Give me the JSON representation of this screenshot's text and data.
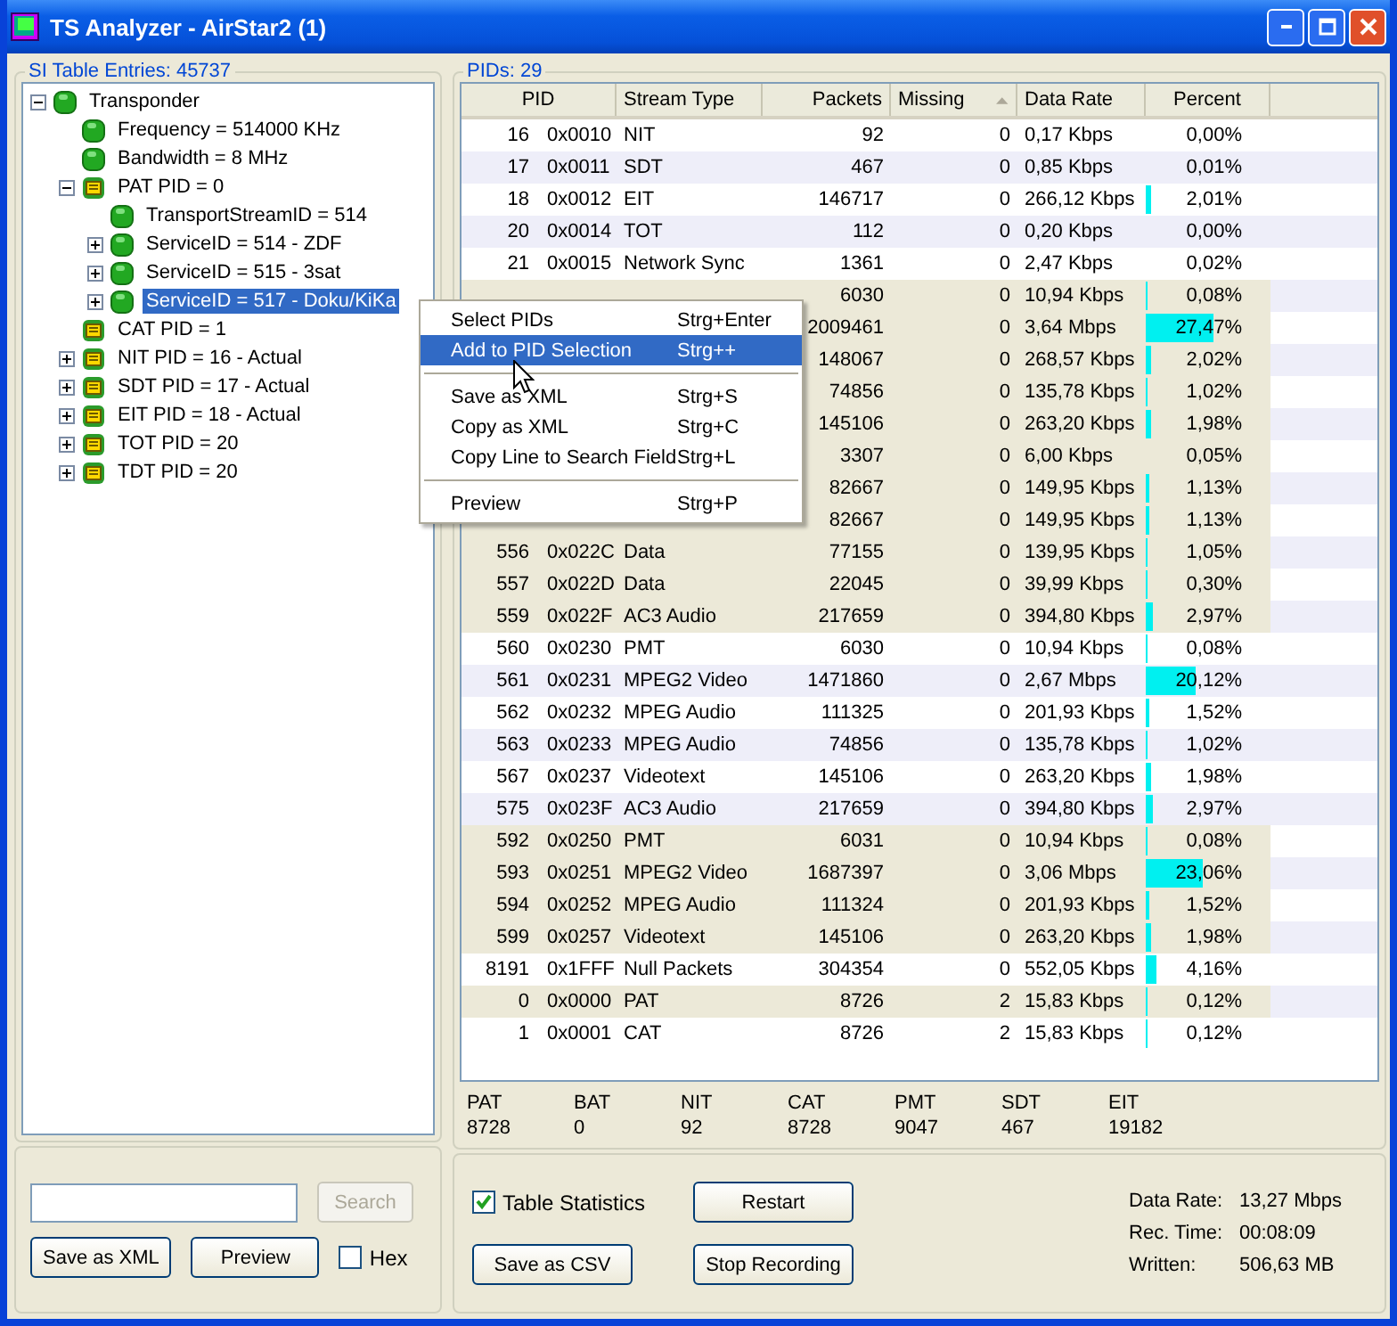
{
  "window": {
    "title": "TS Analyzer - AirStar2 (1)"
  },
  "tree_group": {
    "title": "SI Table Entries: 45737"
  },
  "tree": [
    {
      "label": "Transponder",
      "kind": "ball",
      "expanded": true,
      "selected": false,
      "children": [
        {
          "label": "Frequency = 514000 KHz",
          "kind": "ball",
          "selected": false
        },
        {
          "label": "Bandwidth = 8 MHz",
          "kind": "ball",
          "selected": false
        },
        {
          "label": "PAT PID = 0",
          "kind": "table",
          "expanded": true,
          "selected": false,
          "children": [
            {
              "label": "TransportStreamID = 514",
              "kind": "ball",
              "selected": false
            },
            {
              "label": "ServiceID = 514 - ZDF",
              "kind": "ball",
              "expanded": false,
              "selected": false
            },
            {
              "label": "ServiceID = 515 - 3sat",
              "kind": "ball",
              "expanded": false,
              "selected": false
            },
            {
              "label": "ServiceID = 517 - Doku/KiKa",
              "kind": "ball",
              "expanded": false,
              "selected": true
            }
          ]
        },
        {
          "label": "CAT PID = 1",
          "kind": "table",
          "selected": false
        },
        {
          "label": "NIT PID = 16 - Actual",
          "kind": "table",
          "expanded": false,
          "selected": false
        },
        {
          "label": "SDT PID = 17 - Actual",
          "kind": "table",
          "expanded": false,
          "selected": false
        },
        {
          "label": "EIT PID = 18 - Actual",
          "kind": "table",
          "expanded": false,
          "selected": false
        },
        {
          "label": "TOT PID = 20",
          "kind": "table",
          "expanded": false,
          "selected": false
        },
        {
          "label": "TDT PID = 20",
          "kind": "table",
          "expanded": false,
          "selected": false
        }
      ]
    }
  ],
  "left_controls": {
    "search_button": {
      "label": "Search",
      "disabled": true
    },
    "buttons": [
      {
        "label": "Save as XML",
        "disabled": false
      },
      {
        "label": "Preview",
        "disabled": false
      }
    ],
    "hex": {
      "label": "Hex",
      "checked": false
    }
  },
  "pid_group": {
    "title": "PIDs: 29"
  },
  "table": {
    "columns": [
      {
        "label": "PID",
        "sorted": false
      },
      {
        "label": "Stream Type",
        "sorted": false
      },
      {
        "label": "Packets",
        "sorted": false
      },
      {
        "label": "Missing",
        "sorted": true
      },
      {
        "label": "Data Rate",
        "sorted": false
      },
      {
        "label": "Percent",
        "sorted": false
      }
    ],
    "rows": [
      {
        "pid": "16",
        "hex": "0x0010",
        "type": "NIT",
        "packets": "92",
        "missing": "0",
        "rate": "0,17 Kbps",
        "percent": "0,00%",
        "highlighted": false
      },
      {
        "pid": "17",
        "hex": "0x0011",
        "type": "SDT",
        "packets": "467",
        "missing": "0",
        "rate": "0,85 Kbps",
        "percent": "0,01%",
        "highlighted": false
      },
      {
        "pid": "18",
        "hex": "0x0012",
        "type": "EIT",
        "packets": "146717",
        "missing": "0",
        "rate": "266,12 Kbps",
        "percent": "2,01%",
        "level": 0.0402,
        "highlighted": false
      },
      {
        "pid": "20",
        "hex": "0x0014",
        "type": "TOT",
        "packets": "112",
        "missing": "0",
        "rate": "0,20 Kbps",
        "percent": "0,00%",
        "highlighted": false
      },
      {
        "pid": "21",
        "hex": "0x0015",
        "type": "Network Sync",
        "packets": "1361",
        "missing": "0",
        "rate": "2,47 Kbps",
        "percent": "0,02%",
        "highlighted": false
      },
      {
        "packets": "6030",
        "missing": "0",
        "rate": "10,94 Kbps",
        "percent": "0,08%",
        "level": 0.0016,
        "highlighted": true
      },
      {
        "packets": "2009461",
        "missing": "0",
        "rate": "3,64 Mbps",
        "percent": "27,47%",
        "level": 0.5494,
        "highlighted": true
      },
      {
        "packets": "148067",
        "missing": "0",
        "rate": "268,57 Kbps",
        "percent": "2,02%",
        "level": 0.0404,
        "highlighted": true
      },
      {
        "packets": "74856",
        "missing": "0",
        "rate": "135,78 Kbps",
        "percent": "1,02%",
        "level": 0.0204,
        "highlighted": true
      },
      {
        "packets": "145106",
        "missing": "0",
        "rate": "263,20 Kbps",
        "percent": "1,98%",
        "level": 0.0396,
        "highlighted": true
      },
      {
        "packets": "3307",
        "missing": "0",
        "rate": "6,00 Kbps",
        "percent": "0,05%",
        "level": 0.001,
        "highlighted": true
      },
      {
        "packets": "82667",
        "missing": "0",
        "rate": "149,95 Kbps",
        "percent": "1,13%",
        "level": 0.0226,
        "highlighted": true
      },
      {
        "packets": "82667",
        "missing": "0",
        "rate": "149,95 Kbps",
        "percent": "1,13%",
        "level": 0.0226,
        "highlighted": true
      },
      {
        "pid": "556",
        "hex": "0x022C",
        "type": "Data",
        "packets": "77155",
        "missing": "0",
        "rate": "139,95 Kbps",
        "percent": "1,05%",
        "level": 0.021,
        "highlighted": true
      },
      {
        "pid": "557",
        "hex": "0x022D",
        "type": "Data",
        "packets": "22045",
        "missing": "0",
        "rate": "39,99 Kbps",
        "percent": "0,30%",
        "level": 0.006,
        "highlighted": true
      },
      {
        "pid": "559",
        "hex": "0x022F",
        "type": "AC3 Audio",
        "packets": "217659",
        "missing": "0",
        "rate": "394,80 Kbps",
        "percent": "2,97%",
        "level": 0.0594,
        "highlighted": true
      },
      {
        "pid": "560",
        "hex": "0x0230",
        "type": "PMT",
        "packets": "6030",
        "missing": "0",
        "rate": "10,94 Kbps",
        "percent": "0,08%",
        "level": 0.0016,
        "highlighted": false
      },
      {
        "pid": "561",
        "hex": "0x0231",
        "type": "MPEG2 Video",
        "packets": "1471860",
        "missing": "0",
        "rate": "2,67 Mbps",
        "percent": "20,12%",
        "level": 0.4024,
        "highlighted": false
      },
      {
        "pid": "562",
        "hex": "0x0232",
        "type": "MPEG Audio",
        "packets": "111325",
        "missing": "0",
        "rate": "201,93 Kbps",
        "percent": "1,52%",
        "level": 0.0304,
        "highlighted": false
      },
      {
        "pid": "563",
        "hex": "0x0233",
        "type": "MPEG Audio",
        "packets": "74856",
        "missing": "0",
        "rate": "135,78 Kbps",
        "percent": "1,02%",
        "level": 0.0204,
        "highlighted": false
      },
      {
        "pid": "567",
        "hex": "0x0237",
        "type": "Videotext",
        "packets": "145106",
        "missing": "0",
        "rate": "263,20 Kbps",
        "percent": "1,98%",
        "level": 0.0396,
        "highlighted": false
      },
      {
        "pid": "575",
        "hex": "0x023F",
        "type": "AC3 Audio",
        "packets": "217659",
        "missing": "0",
        "rate": "394,80 Kbps",
        "percent": "2,97%",
        "level": 0.0594,
        "highlighted": false
      },
      {
        "pid": "592",
        "hex": "0x0250",
        "type": "PMT",
        "packets": "6031",
        "missing": "0",
        "rate": "10,94 Kbps",
        "percent": "0,08%",
        "level": 0.0016,
        "highlighted": true
      },
      {
        "pid": "593",
        "hex": "0x0251",
        "type": "MPEG2 Video",
        "packets": "1687397",
        "missing": "0",
        "rate": "3,06 Mbps",
        "percent": "23,06%",
        "level": 0.4612,
        "highlighted": true
      },
      {
        "pid": "594",
        "hex": "0x0252",
        "type": "MPEG Audio",
        "packets": "111324",
        "missing": "0",
        "rate": "201,93 Kbps",
        "percent": "1,52%",
        "level": 0.0304,
        "highlighted": true
      },
      {
        "pid": "599",
        "hex": "0x0257",
        "type": "Videotext",
        "packets": "145106",
        "missing": "0",
        "rate": "263,20 Kbps",
        "percent": "1,98%",
        "level": 0.0396,
        "highlighted": true
      },
      {
        "pid": "8191",
        "hex": "0x1FFF",
        "type": "Null Packets",
        "packets": "304354",
        "missing": "0",
        "rate": "552,05 Kbps",
        "percent": "4,16%",
        "level": 0.0832,
        "highlighted": false
      },
      {
        "pid": "0",
        "hex": "0x0000",
        "type": "PAT",
        "packets": "8726",
        "missing": "2",
        "rate": "15,83 Kbps",
        "percent": "0,12%",
        "level": 0.0024,
        "highlighted": true
      },
      {
        "pid": "1",
        "hex": "0x0001",
        "type": "CAT",
        "packets": "8726",
        "missing": "2",
        "rate": "15,83 Kbps",
        "percent": "0,12%",
        "level": 0.0024,
        "highlighted": false
      }
    ]
  },
  "table_counts": [
    {
      "label": "PAT",
      "value": "8728"
    },
    {
      "label": "BAT",
      "value": "0"
    },
    {
      "label": "NIT",
      "value": "92"
    },
    {
      "label": "CAT",
      "value": "8728"
    },
    {
      "label": "PMT",
      "value": "9047"
    },
    {
      "label": "SDT",
      "value": "467"
    },
    {
      "label": "EIT",
      "value": "19182"
    }
  ],
  "right_controls": {
    "table_statistics": {
      "label": "Table Statistics",
      "checked": true
    },
    "buttons": [
      {
        "label": "Restart",
        "disabled": false
      },
      {
        "label": "Save as CSV",
        "disabled": false
      },
      {
        "label": "Stop Recording",
        "disabled": false
      }
    ],
    "info": [
      {
        "label": "Data Rate:",
        "value": "13,27 Mbps"
      },
      {
        "label": "Rec. Time:",
        "value": "00:08:09"
      },
      {
        "label": "Written:",
        "value": "506,63 MB"
      }
    ]
  },
  "context_menu": [
    {
      "kind": "item",
      "label": "Select PIDs",
      "shortcut": "Strg+Enter",
      "selected": false
    },
    {
      "kind": "item",
      "label": "Add to PID Selection",
      "shortcut": "Strg++",
      "selected": true
    },
    {
      "kind": "separator"
    },
    {
      "kind": "item",
      "label": "Save as XML",
      "shortcut": "Strg+S",
      "selected": false
    },
    {
      "kind": "item",
      "label": "Copy as XML",
      "shortcut": "Strg+C",
      "selected": false
    },
    {
      "kind": "item",
      "label": "Copy Line to Search Field",
      "shortcut": "Strg+L",
      "selected": false
    },
    {
      "kind": "separator"
    },
    {
      "kind": "item",
      "label": "Preview",
      "shortcut": "Strg+P",
      "selected": false
    }
  ]
}
